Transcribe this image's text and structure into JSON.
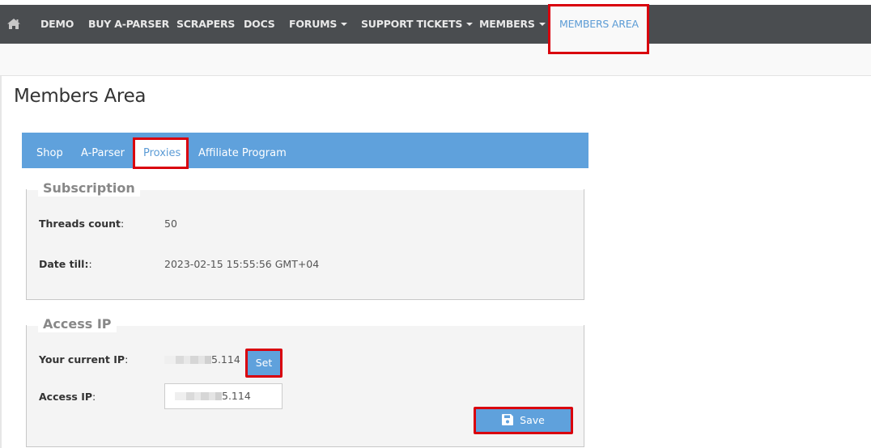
{
  "navbar": {
    "home_icon": "home-icon",
    "items": [
      {
        "label": "DEMO",
        "has_caret": false
      },
      {
        "label": "BUY A-PARSER",
        "has_caret": false
      },
      {
        "label": "SCRAPERS",
        "has_caret": false
      },
      {
        "label": "DOCS",
        "has_caret": false
      },
      {
        "label": "FORUMS",
        "has_caret": true
      },
      {
        "label": "SUPPORT TICKETS",
        "has_caret": true
      },
      {
        "label": "MEMBERS",
        "has_caret": true
      },
      {
        "label": "MEMBERS AREA",
        "has_caret": false,
        "active": true
      }
    ]
  },
  "page": {
    "title": "Members Area"
  },
  "tabs": [
    {
      "label": "Shop"
    },
    {
      "label": "A-Parser"
    },
    {
      "label": "Proxies",
      "active": true
    },
    {
      "label": "Affiliate Program"
    }
  ],
  "subscription": {
    "legend": "Subscription",
    "threads_label": "Threads count",
    "threads_value": "50",
    "date_label": "Date till:",
    "date_value": "2023-02-15 15:55:56 GMT+04"
  },
  "access_ip": {
    "legend": "Access IP",
    "current_ip_label": "Your current IP",
    "current_ip_suffix": "5.114",
    "set_button": "Set",
    "access_ip_label": "Access IP",
    "access_ip_value_suffix": "5.114",
    "save_button": "Save",
    "save_icon": "floppy-disk-icon"
  },
  "colors": {
    "navbar_bg": "#4a4d50",
    "accent": "#5fa1dc",
    "highlight_red": "#d9000d",
    "panel_bg": "#f4f4f4"
  },
  "colon": ":"
}
